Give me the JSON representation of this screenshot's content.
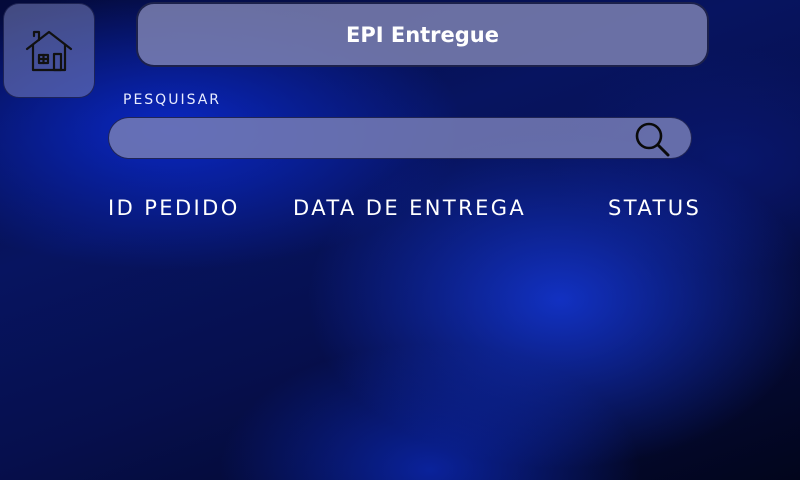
{
  "header": {
    "title": "EPI Entregue",
    "home_icon": "home-icon"
  },
  "search": {
    "label": "PESQUISAR",
    "value": "",
    "placeholder": "",
    "icon": "search-icon"
  },
  "table": {
    "columns": [
      "ID PEDIDO",
      "DATA DE ENTREGA",
      "STATUS"
    ],
    "rows": []
  }
}
